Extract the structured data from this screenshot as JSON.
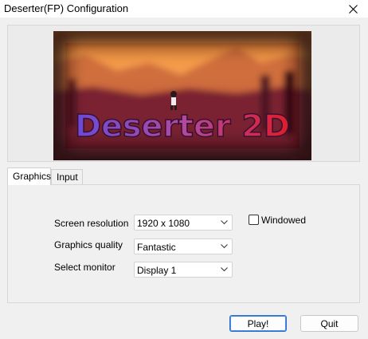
{
  "window": {
    "title": "Deserter(FP) Configuration"
  },
  "banner": {
    "logo_text": "Deserter 2D"
  },
  "tabs": [
    {
      "label": "Graphics",
      "active": true
    },
    {
      "label": "Input",
      "active": false
    }
  ],
  "graphics": {
    "resolution_label": "Screen resolution",
    "resolution_value": "1920 x 1080",
    "quality_label": "Graphics quality",
    "quality_value": "Fantastic",
    "monitor_label": "Select monitor",
    "monitor_value": "Display 1",
    "windowed_label": "Windowed",
    "windowed_checked": false
  },
  "buttons": {
    "play": "Play!",
    "quit": "Quit"
  },
  "icons": {
    "close": "close-icon",
    "dropdown": "chevron-down-icon"
  },
  "colors": {
    "default_button_border": "#2a6fd0",
    "logo_left": "#7b4fd0",
    "logo_right": "#d92030"
  }
}
